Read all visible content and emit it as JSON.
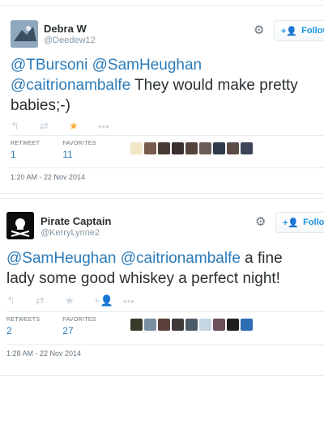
{
  "tweets": [
    {
      "name": "Debra W",
      "handle": "@Deedew12",
      "follow_label": "Follow",
      "text_parts": [
        {
          "t": "@TBursoni",
          "mention": true
        },
        {
          "t": " ",
          "mention": false
        },
        {
          "t": "@SamHeughan",
          "mention": true
        },
        {
          "t": " ",
          "mention": false
        },
        {
          "t": "@caitrionambalfe",
          "mention": true
        },
        {
          "t": " They would make pretty babies;-)",
          "mention": false
        }
      ],
      "retweet_label": "RETWEET",
      "retweet_count": "1",
      "favorites_label": "FAVORITES",
      "favorites_count": "11",
      "favorited": true,
      "timestamp": "1:20 AM - 22 Nov 2014"
    },
    {
      "name": "Pirate Captain",
      "handle": "@KerryLynne2",
      "follow_label": "Follow",
      "text_parts": [
        {
          "t": "@SamHeughan",
          "mention": true
        },
        {
          "t": " ",
          "mention": false
        },
        {
          "t": "@caitrionambalfe",
          "mention": true
        },
        {
          "t": " a fine lady some good whiskey a perfect night!",
          "mention": false
        }
      ],
      "retweet_label": "RETWEETS",
      "retweet_count": "2",
      "favorites_label": "FAVORITES",
      "favorites_count": "27",
      "favorited": false,
      "timestamp": "1:28 AM - 22 Nov 2014"
    }
  ],
  "icons": {
    "reply": "reply-icon",
    "retweet": "retweet-icon",
    "favorite": "star-icon",
    "more": "more-icon",
    "gear": "gear-icon",
    "follow": "add-user-icon"
  },
  "colors": {
    "link": "#2b7bb9",
    "favorite_on": "#ffac33",
    "muted": "#8899a6"
  }
}
